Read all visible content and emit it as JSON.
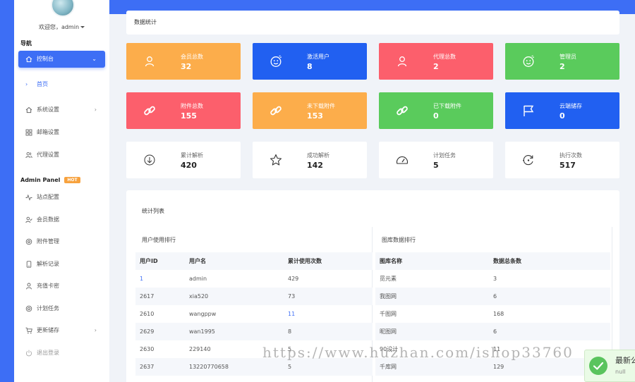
{
  "sidebar": {
    "welcome": "欢迎您，admin",
    "nav_title": "导航",
    "panel_title": "Admin Panel",
    "hot_badge": "HOT",
    "items": [
      {
        "label": "控制台"
      },
      {
        "label": "首页"
      },
      {
        "label": "系统设置"
      },
      {
        "label": "邮箱设置"
      },
      {
        "label": "代理设置"
      },
      {
        "label": "站点配置"
      },
      {
        "label": "会员数据"
      },
      {
        "label": "附件管理"
      },
      {
        "label": "解析记录"
      },
      {
        "label": "充值卡密"
      },
      {
        "label": "计划任务"
      },
      {
        "label": "更新储存"
      },
      {
        "label": "退出登录"
      }
    ]
  },
  "header": {
    "title": "数据统计"
  },
  "stats": [
    {
      "label": "会员总数",
      "value": "32",
      "color": "#fcad4b",
      "icon": "user-icon"
    },
    {
      "label": "激活用户",
      "value": "8",
      "color": "#2160f1",
      "icon": "smile-face-icon"
    },
    {
      "label": "代理总数",
      "value": "2",
      "color": "#fc5f6c",
      "icon": "user-icon"
    },
    {
      "label": "管理员",
      "value": "2",
      "color": "#5acb5c",
      "icon": "smile-face-icon"
    },
    {
      "label": "附件总数",
      "value": "155",
      "color": "#fc5f6c",
      "icon": "link-icon"
    },
    {
      "label": "未下载附件",
      "value": "153",
      "color": "#fcad4b",
      "icon": "link-icon"
    },
    {
      "label": "已下载附件",
      "value": "0",
      "color": "#5acb5c",
      "icon": "link-icon"
    },
    {
      "label": "云端储存",
      "value": "0",
      "color": "#2160f1",
      "icon": "flag-icon"
    },
    {
      "label": "累计解析",
      "value": "420",
      "color": "#ffffff",
      "icon": "download-circle-icon"
    },
    {
      "label": "成功解析",
      "value": "142",
      "color": "#ffffff",
      "icon": "star-icon"
    },
    {
      "label": "计划任务",
      "value": "5",
      "color": "#ffffff",
      "icon": "gauge-icon"
    },
    {
      "label": "执行次数",
      "value": "517",
      "color": "#ffffff",
      "icon": "refresh-icon"
    }
  ],
  "list": {
    "title": "统计列表",
    "user_rank": {
      "title": "用户使用排行",
      "headers": [
        "用户ID",
        "用户名",
        "累计使用次数"
      ],
      "rows": [
        [
          "1",
          "admin",
          "429"
        ],
        [
          "2617",
          "xia520",
          "73"
        ],
        [
          "2610",
          "wangppw",
          "11"
        ],
        [
          "2629",
          "wan1995",
          "8"
        ],
        [
          "2630",
          "229140",
          "5"
        ],
        [
          "2637",
          "13220770658",
          "5"
        ]
      ]
    },
    "gallery_rank": {
      "title": "图库数据排行",
      "headers": [
        "图库名称",
        "数据总条数"
      ],
      "rows": [
        [
          "觅元素",
          "3"
        ],
        [
          "我图网",
          "6"
        ],
        [
          "千图网",
          "168"
        ],
        [
          "昵图网",
          "6"
        ],
        [
          "90设计",
          "11"
        ],
        [
          "千库网",
          "129"
        ]
      ]
    }
  },
  "watermark": "https://www.huzhan.com/ishop33760",
  "toast": {
    "title": "最新公告",
    "subtitle": "null"
  }
}
